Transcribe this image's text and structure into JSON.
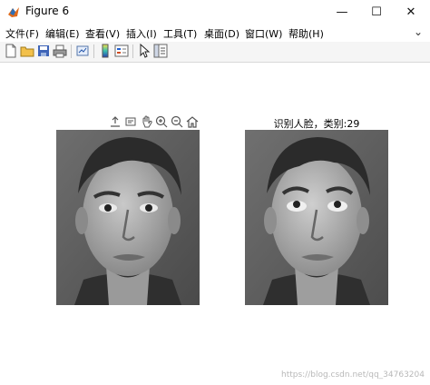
{
  "window": {
    "title": "Figure 6",
    "minimize": "—",
    "maximize": "☐",
    "close": "✕"
  },
  "menu": [
    {
      "key": "file",
      "label": "文件(F)"
    },
    {
      "key": "edit",
      "label": "编辑(E)"
    },
    {
      "key": "view",
      "label": "查看(V)"
    },
    {
      "key": "insert",
      "label": "插入(I)"
    },
    {
      "key": "tools",
      "label": "工具(T)"
    },
    {
      "key": "desktop",
      "label": "桌面(D)"
    },
    {
      "key": "window",
      "label": "窗口(W)"
    },
    {
      "key": "help",
      "label": "帮助(H)"
    }
  ],
  "menu_overflow": "⌄",
  "toolbar_icons": [
    "new-figure-icon",
    "open-file-icon",
    "save-icon",
    "print-icon",
    "link-plot-icon",
    "colorbar-icon",
    "legend-icon",
    "edit-pointer-icon",
    "property-inspector-icon"
  ],
  "axes_toolbar_icons": [
    "export-icon",
    "brush-icon",
    "pan-icon",
    "zoom-in-icon",
    "zoom-out-icon",
    "home-icon"
  ],
  "result_caption": "识别人脸，类别:29",
  "watermark": "https://blog.csdn.net/qq_34763204"
}
